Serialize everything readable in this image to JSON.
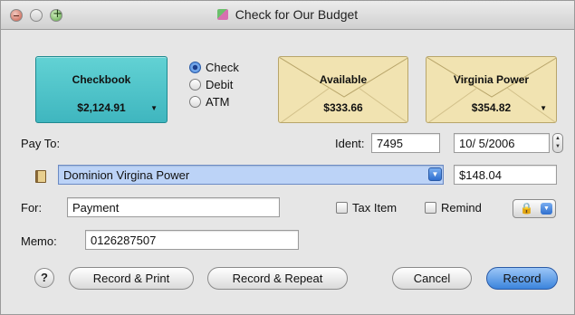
{
  "window": {
    "title": "Check for Our Budget"
  },
  "accounts": {
    "checkbook": {
      "name": "Checkbook",
      "amount": "$2,124.91"
    },
    "available": {
      "name": "Available",
      "amount": "$333.66"
    },
    "virginia": {
      "name": "Virginia Power",
      "amount": "$354.82"
    }
  },
  "type_options": [
    {
      "label": "Check",
      "selected": true
    },
    {
      "label": "Debit",
      "selected": false
    },
    {
      "label": "ATM",
      "selected": false
    }
  ],
  "form": {
    "pay_to_label": "Pay To:",
    "ident_label": "Ident:",
    "ident_value": "7495",
    "date_value": "10/ 5/2006",
    "payee_value": "Dominion Virgina Power",
    "amount_value": "$148.04",
    "for_label": "For:",
    "for_value": "Payment",
    "memo_label": "Memo:",
    "memo_value": "0126287507",
    "tax_item_label": "Tax Item",
    "remind_label": "Remind"
  },
  "buttons": {
    "help": "?",
    "record_print": "Record & Print",
    "record_repeat": "Record & Repeat",
    "cancel": "Cancel",
    "record": "Record"
  },
  "colors": {
    "checkbook": "#4fc4ca",
    "envelope": "#f1e3b1",
    "default_button": "#3b84dc",
    "payee_highlight": "#bcd3f7"
  }
}
